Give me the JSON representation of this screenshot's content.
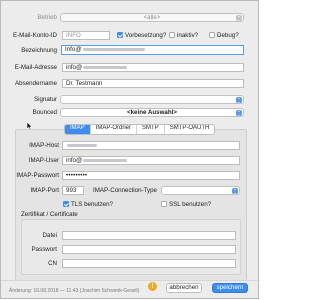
{
  "fields": {
    "betrieb": {
      "label": "Betrieb",
      "value": "<alle>"
    },
    "konto_id": {
      "label": "E-Mail-Konto-ID",
      "value": "INFO"
    },
    "vorbesetzung": {
      "label": "Vorbesetzung?",
      "checked": true
    },
    "inaktiv": {
      "label": "inaktiv?",
      "checked": false
    },
    "debug": {
      "label": "Debug?",
      "checked": false
    },
    "bezeichnung": {
      "label": "Bezeichnung",
      "value": "Info@"
    },
    "email_adresse": {
      "label": "E-Mail-Adresse",
      "value": "info@"
    },
    "absendername": {
      "label": "Absendername",
      "value": "Dr. Testmann"
    },
    "signatur": {
      "label": "Signatur",
      "value": ""
    },
    "bounced": {
      "label": "Bounced",
      "value": "<keine Auswahl>"
    }
  },
  "tabs": [
    "IMAP",
    "IMAP-Ordner",
    "SMTP",
    "SMTP-OAUTH"
  ],
  "imap": {
    "host": {
      "label": "IMAP-Host",
      "value": ""
    },
    "user": {
      "label": "IMAP-User",
      "value": "info@"
    },
    "password": {
      "label": "IMAP-Passwort",
      "value": "•••••••••"
    },
    "port": {
      "label": "IMAP-Port",
      "value": "993"
    },
    "connection_type": {
      "label": "IMAP-Connection-Type",
      "value": ""
    },
    "tls": {
      "label": "TLS benutzen?",
      "checked": true
    },
    "ssl": {
      "label": "SSL benutzen?",
      "checked": false
    }
  },
  "certificate": {
    "title": "Zertifikat / Certificate",
    "datei": "Datei",
    "passwort": "Passwort",
    "cn": "CN"
  },
  "footer": {
    "status": "Änderung: 16.08.2018 — 11:43 (Joachim Schwenk-Gesell)",
    "warning_symbol": "!",
    "cancel_label": "abbrechen",
    "save_label": "speichern"
  },
  "colors": {
    "accent": "#3f8cf0",
    "warning": "#f4a81d"
  }
}
